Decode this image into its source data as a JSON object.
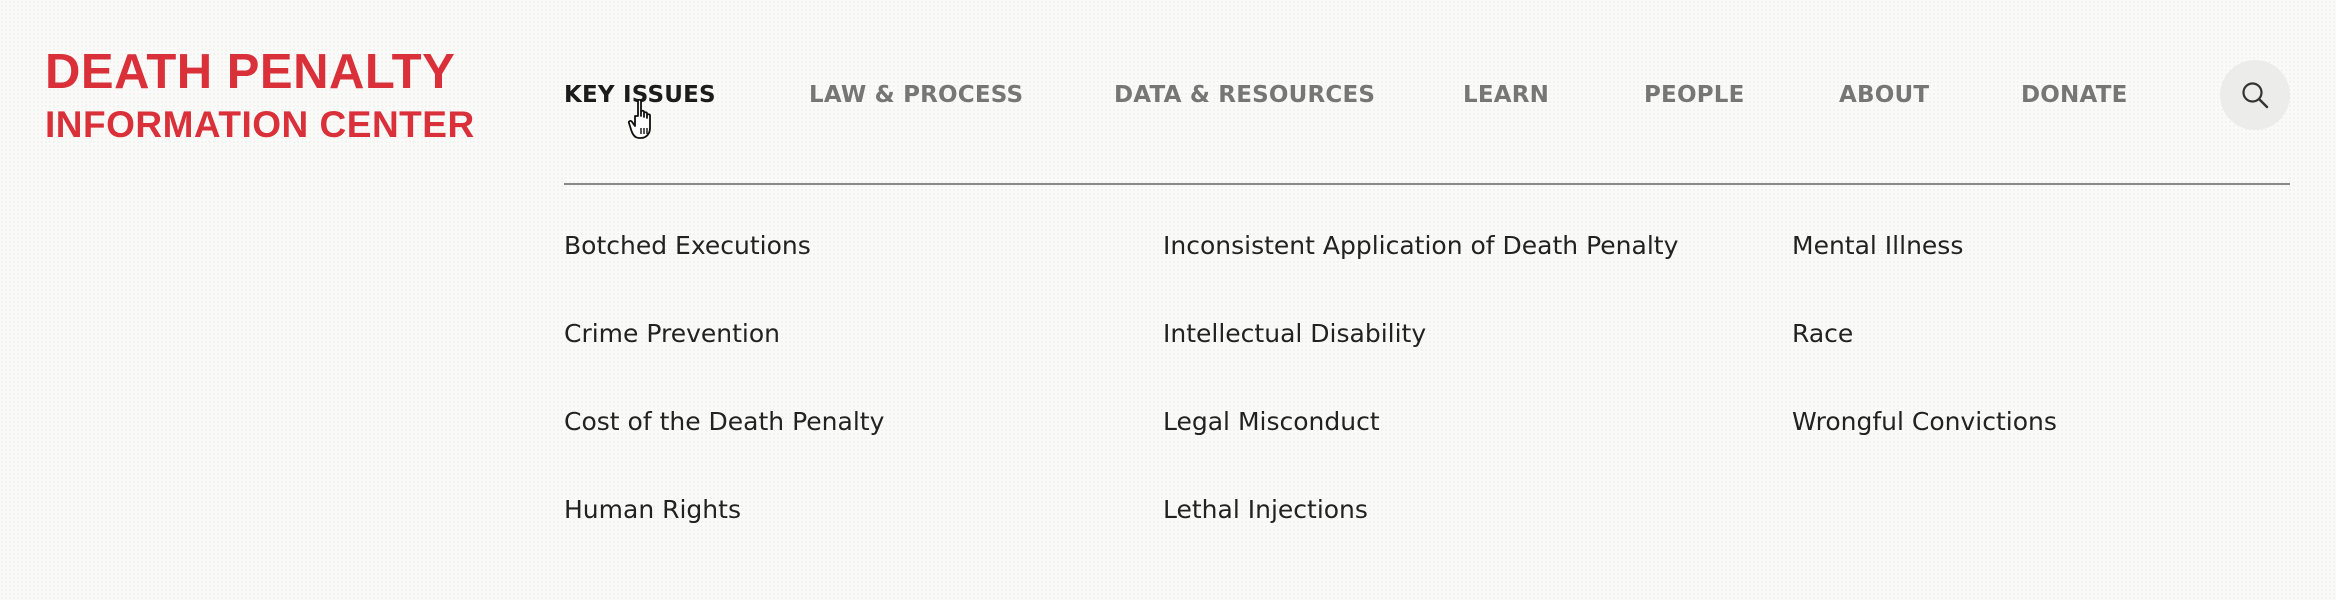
{
  "logo": {
    "line1": "DEATH PENALTY",
    "line2": "INFORMATION CENTER"
  },
  "nav": {
    "items": [
      {
        "label": "KEY ISSUES"
      },
      {
        "label": "LAW & PROCESS"
      },
      {
        "label": "DATA & RESOURCES"
      },
      {
        "label": "LEARN"
      },
      {
        "label": "PEOPLE"
      },
      {
        "label": "ABOUT"
      },
      {
        "label": "DONATE"
      }
    ],
    "active": "KEY ISSUES",
    "search_icon": "search-icon"
  },
  "dropdown": {
    "columns": [
      {
        "links": [
          "Botched Executions",
          "Crime Prevention",
          "Cost of the Death Penalty",
          "Human Rights"
        ]
      },
      {
        "links": [
          "Inconsistent Application of Death Penalty",
          "Intellectual Disability",
          "Legal Misconduct",
          "Lethal Injections"
        ]
      },
      {
        "links": [
          "Mental Illness",
          "Race",
          "Wrongful Convictions"
        ]
      }
    ]
  },
  "colors": {
    "brand_red": "#d93039",
    "nav_inactive": "#767676",
    "nav_active": "#1c1c1c",
    "text": "#222222",
    "divider": "#8a8a8a",
    "search_bg": "#ececea"
  },
  "cursor_icon": "hand-pointer-icon"
}
